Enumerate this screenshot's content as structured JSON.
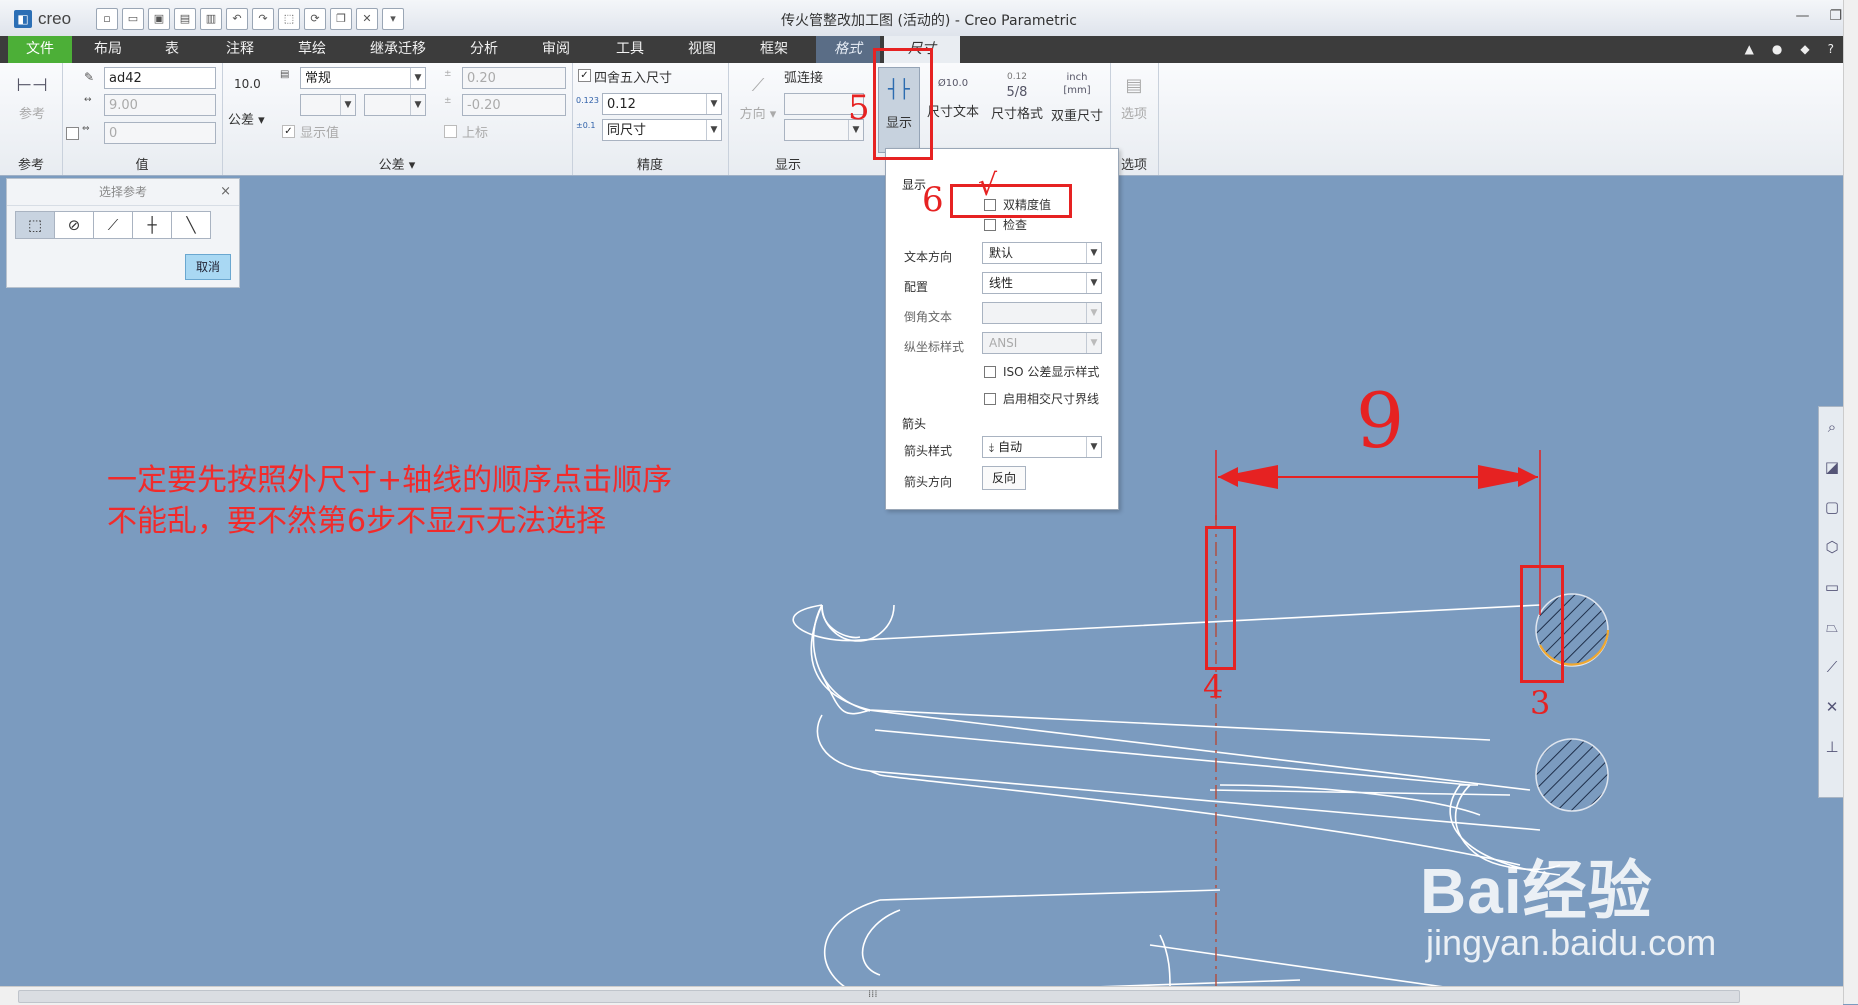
{
  "app": {
    "logo": "creo",
    "window_title": "传火管整改加工图 (活动的) - Creo Parametric"
  },
  "tabs": [
    "文件",
    "布局",
    "表",
    "注释",
    "草绘",
    "继承迁移",
    "分析",
    "审阅",
    "工具",
    "视图",
    "框架",
    "格式",
    "尺寸"
  ],
  "ribbon": {
    "reference": {
      "button": "参考",
      "group": "参考"
    },
    "value": {
      "name": "ad42",
      "nominal": "9.00",
      "override": "0",
      "group": "值"
    },
    "tolerance": {
      "display": "10.0",
      "button": "公差",
      "mode": "常规",
      "show_value": "显示值",
      "upper": "0.20",
      "lower": "-0.20",
      "upper_label": "上标",
      "group": "公差"
    },
    "precision": {
      "round": "四舍五入尺寸",
      "value": "0.12",
      "tol_precision": "同尺寸",
      "group": "精度"
    },
    "display": {
      "direction": "方向",
      "arc": "弧连接",
      "display_btn": "显示",
      "dim_text": "尺寸文本",
      "dim_text_icon": "Ø10.0",
      "dim_format": "尺寸格式",
      "dim_format_icon_top": "0.12",
      "dim_format_icon": "5/8",
      "dual": "双重尺寸",
      "dual_icon_top": "inch",
      "dual_icon_bottom": "[mm]",
      "group": "显示"
    },
    "options": {
      "button": "选项",
      "group": "选项"
    }
  },
  "select_panel": {
    "title": "选择参考",
    "close": "×",
    "tools": [
      "⬚",
      "⊘",
      "⟋",
      "┼",
      "╲"
    ],
    "cancel": "取消"
  },
  "display_dropdown": {
    "heading": "显示",
    "dual_precision": "双精度值",
    "inspection": "检查",
    "text_orientation_label": "文本方向",
    "text_orientation": "默认",
    "config_label": "配置",
    "config": "线性",
    "chamfer_label": "倒角文本",
    "ordinate_label": "纵坐标样式",
    "ordinate": "ANSI",
    "iso_tol": "ISO 公差显示样式",
    "intersect": "启用相交尺寸界线",
    "arrow_heading": "箭头",
    "arrow_style_label": "箭头样式",
    "arrow_style": "自动",
    "arrow_dir_label": "箭头方向",
    "flip": "反向"
  },
  "drawing": {
    "dimension_value": "9"
  },
  "annotations": {
    "step5": "5",
    "step6": "6",
    "step3": "3",
    "step4": "4",
    "check": "√",
    "note_line1": "一定要先按照外尺寸+轴线的顺序点击顺序",
    "note_line2": "不能乱，要不然第6步不显示无法选择"
  },
  "watermark": {
    "main": "Bai经验",
    "sub": "jingyan.baidu.com"
  },
  "colors": {
    "file_tab": "#4caf37",
    "canvas": "#7b9bbf",
    "annotation": "#e62222",
    "highlight": "#f0a830"
  },
  "scroll": {
    "grip": "⁞⁞⁞"
  }
}
